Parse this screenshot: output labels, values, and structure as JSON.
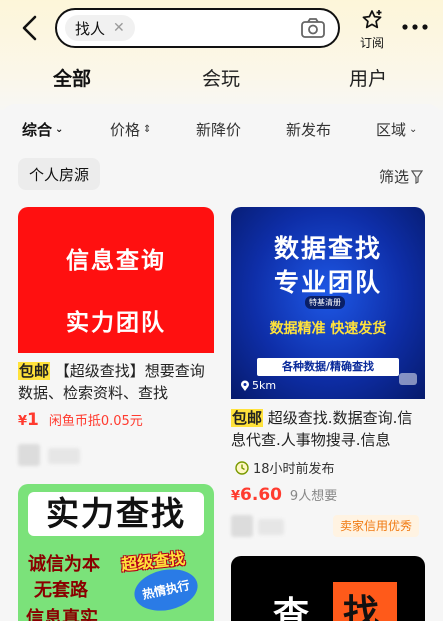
{
  "search": {
    "query": "找人"
  },
  "header": {
    "subscribe_label": "订阅"
  },
  "tabs": [
    {
      "label": "全部"
    },
    {
      "label": "会玩"
    },
    {
      "label": "用户"
    }
  ],
  "filters": [
    {
      "label": "综合"
    },
    {
      "label": "价格"
    },
    {
      "label": "新降价"
    },
    {
      "label": "新发布"
    },
    {
      "label": "区域"
    }
  ],
  "tag_chip": "个人房源",
  "filter_button": "筛选",
  "listings": [
    {
      "image_line1": "信息查询",
      "image_line2": "实力团队",
      "badge": "包邮",
      "title": "【超级查找】想要查询数据、检索资料、查找",
      "price_symbol": "¥",
      "price": "1",
      "price_note": "闲鱼币抵0.05元"
    },
    {
      "image_line1": "数据查找",
      "image_line2": "专业团队",
      "image_brand": "特基清册",
      "image_line3": "数据精准 快速发货",
      "image_line4": "各种数据/精确查找",
      "distance": "5km",
      "badge": "包邮",
      "title": "超级查找.数据查询.信息代查.人事物搜寻.信息",
      "time": "18小时前发布",
      "price_symbol": "¥",
      "price": "6.60",
      "wants": "9人想要",
      "seller_badge": "卖家信用优秀"
    },
    {
      "image_big": "实力查找",
      "image_line1": "诚信为本",
      "image_line2": "无套路",
      "image_line3": "信息真实",
      "image_super": "超级查找",
      "image_burst": "热情执行"
    },
    {
      "image_char1": "查",
      "image_char2": "找"
    }
  ],
  "colors": {
    "accent_yellow": "#ffe23b",
    "price_red": "#ff3b2f",
    "seller_orange": "#f07a12"
  }
}
